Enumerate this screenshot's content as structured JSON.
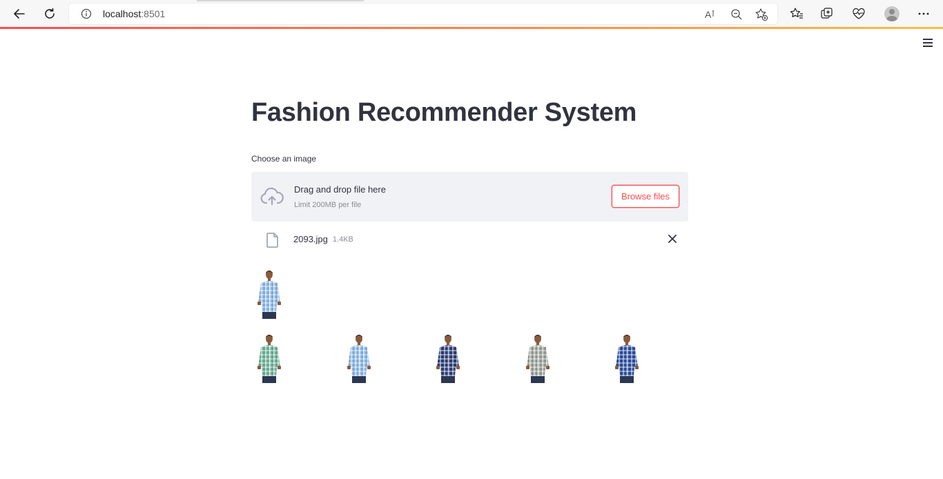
{
  "browser": {
    "url_host": "localhost",
    "url_port": ":8501",
    "icons": [
      "back-icon",
      "refresh-icon",
      "info-icon",
      "read-aloud-icon",
      "zoom-out-icon",
      "add-favorite-icon",
      "favorites-icon",
      "collections-icon",
      "health-icon",
      "profile-icon",
      "more-icon"
    ]
  },
  "app": {
    "title": "Fashion Recommender System",
    "menu_icon": "hamburger-menu-icon",
    "uploader": {
      "label": "Choose an image",
      "drop_text": "Drag and drop file here",
      "limit_text": "Limit 200MB per file",
      "browse_label": "Browse files"
    },
    "uploaded_file": {
      "name": "2093.jpg",
      "size": "1.4KB"
    },
    "query_image": {
      "shirt_color": "#8cb8e6",
      "pattern": "light-blue-check"
    },
    "recommendations": [
      {
        "shirt_color": "#6fb39a",
        "pattern": "green-check"
      },
      {
        "shirt_color": "#8cb8e6",
        "pattern": "light-blue-check"
      },
      {
        "shirt_color": "#2d3f78",
        "pattern": "navy-check"
      },
      {
        "shirt_color": "#9aa39a",
        "pattern": "grey-check"
      },
      {
        "shirt_color": "#2c4fa0",
        "pattern": "royal-blue-check"
      }
    ],
    "colors": {
      "accent": "#ff4b4b",
      "dropzone_bg": "#f0f2f6",
      "text": "#31333f"
    }
  }
}
